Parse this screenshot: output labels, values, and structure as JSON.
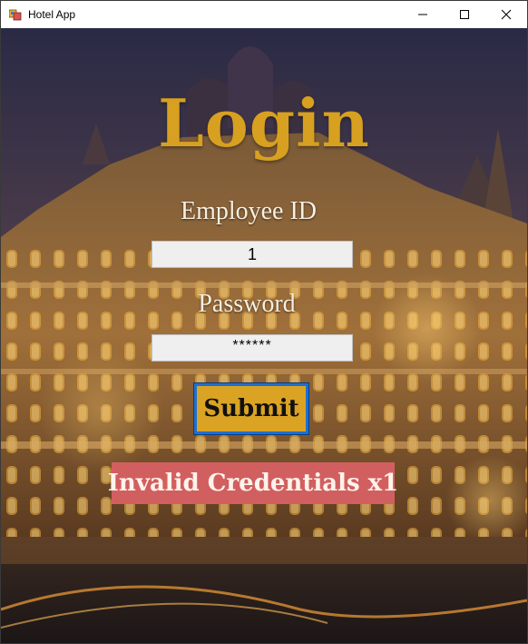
{
  "window": {
    "title": "Hotel App",
    "icons": {
      "app": "hotel-app-icon",
      "minimize": "minimize-icon",
      "maximize": "maximize-icon",
      "close": "close-icon"
    }
  },
  "login": {
    "title": "Login",
    "employee_id_label": "Employee ID",
    "employee_id_value": "1",
    "password_label": "Password",
    "password_value": "******",
    "submit_label": "Submit",
    "error_message": "Invalid Credentials x1"
  },
  "colors": {
    "title": "#d8a020",
    "submit_bg": "#dba323",
    "submit_border": "#1e6fd0",
    "error_bg": "#d25f5f",
    "field_bg": "#efefef"
  }
}
